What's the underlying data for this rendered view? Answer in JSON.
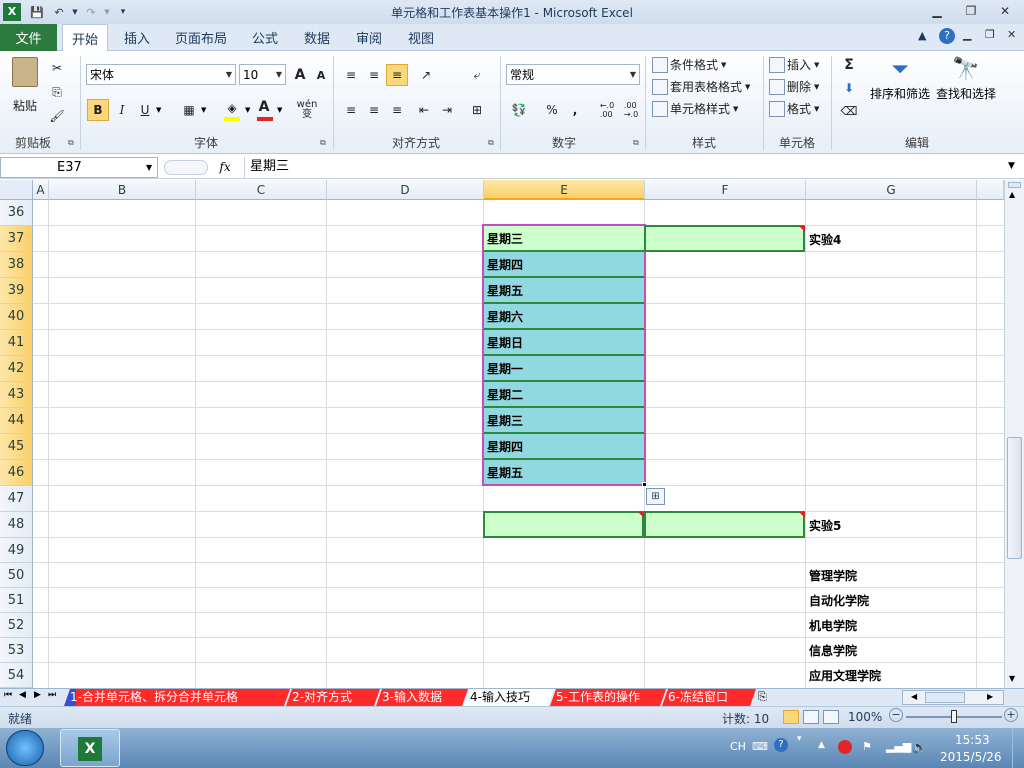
{
  "window": {
    "title": "单元格和工作表基本操作1 - Microsoft Excel"
  },
  "tabs": [
    "文件",
    "开始",
    "插入",
    "页面布局",
    "公式",
    "数据",
    "审阅",
    "视图"
  ],
  "ribbon": {
    "clipboard": {
      "paste": "粘贴",
      "group": "剪贴板"
    },
    "font": {
      "name": "宋体",
      "size": "10",
      "group": "字体",
      "bold": "B",
      "italic": "I",
      "underline": "U",
      "grow": "A",
      "shrink": "A",
      "font_color": "A",
      "phonetic": "wén\n变"
    },
    "alignment": {
      "group": "对齐方式"
    },
    "number": {
      "format": "常规",
      "group": "数字",
      "percent": "%",
      "comma": ",",
      "inc_decimal": "←.0\n.00",
      "dec_decimal": ".00\n→.0"
    },
    "styles": {
      "conditional": "条件格式",
      "table": "套用表格格式",
      "cell_styles": "单元格样式",
      "group": "样式"
    },
    "cells": {
      "insert": "插入",
      "delete": "删除",
      "format": "格式",
      "group": "单元格"
    },
    "editing": {
      "sigma": "Σ",
      "sort": "排序和筛选",
      "find": "查找和选择",
      "group": "编辑"
    }
  },
  "formula_bar": {
    "name_box": "E37",
    "fx": "fx",
    "value": "星期三"
  },
  "columns": [
    "A",
    "B",
    "C",
    "D",
    "E",
    "F",
    "G"
  ],
  "rows": [
    "36",
    "37",
    "38",
    "39",
    "40",
    "41",
    "42",
    "43",
    "44",
    "45",
    "46",
    "47",
    "48",
    "49",
    "50",
    "51",
    "52",
    "53",
    "54"
  ],
  "cells": {
    "E": [
      "星期三",
      "星期四",
      "星期五",
      "星期六",
      "星期日",
      "星期一",
      "星期二",
      "星期三",
      "星期四",
      "星期五"
    ],
    "G37": "实验4",
    "G48": "实验5",
    "G_list": [
      "管理学院",
      "自动化学院",
      "机电学院",
      "信息学院",
      "应用文理学院"
    ]
  },
  "sheets": [
    "1-合并单元格、拆分合并单元格",
    "2-对齐方式",
    "3-输入数据",
    "4-输入技巧",
    "5-工作表的操作",
    "6-冻结窗口"
  ],
  "status": {
    "mode": "就绪",
    "count": "计数: 10",
    "zoom": "100%"
  },
  "taskbar": {
    "lang": "CH",
    "time": "15:53",
    "date": "2015/5/26"
  }
}
